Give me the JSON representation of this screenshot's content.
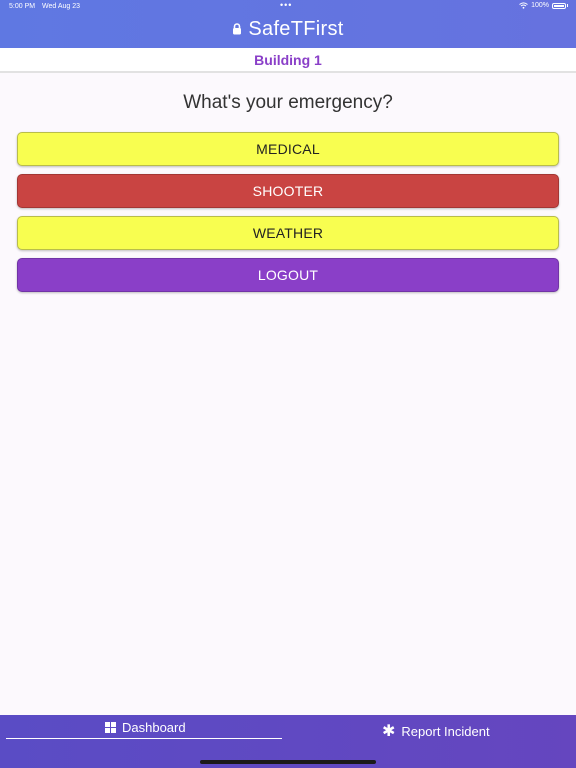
{
  "status_bar": {
    "time": "5:00 PM",
    "date": "Wed Aug 23",
    "battery": "100%",
    "dots": "•••"
  },
  "header": {
    "title": "SafeTFirst",
    "icon": "lock-icon"
  },
  "subheader": {
    "building": "Building 1"
  },
  "main": {
    "prompt": "What's your emergency?",
    "buttons": [
      {
        "label": "MEDICAL",
        "color": "#f8fe50"
      },
      {
        "label": "SHOOTER",
        "color": "#c94442"
      },
      {
        "label": "WEATHER",
        "color": "#f8fe50"
      },
      {
        "label": "LOGOUT",
        "color": "#8a3fc8"
      }
    ]
  },
  "tabbar": {
    "tabs": [
      {
        "label": "Dashboard",
        "icon": "dashboard-grid-icon",
        "active": true
      },
      {
        "label": "Report Incident",
        "icon": "asterisk-icon",
        "active": false
      }
    ]
  },
  "colors": {
    "header": "#6075e1",
    "accent": "#8a3fc8",
    "tabbar": "#5f49c2"
  }
}
